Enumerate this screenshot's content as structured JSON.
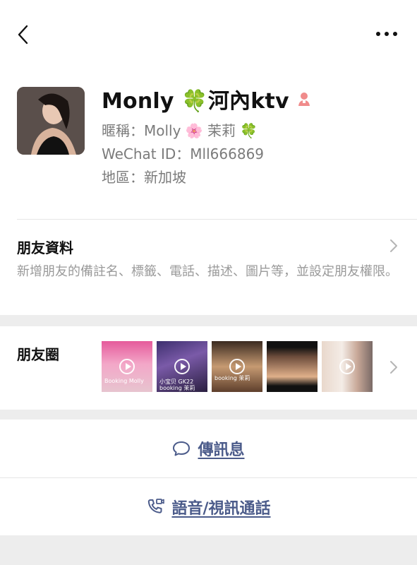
{
  "header": {
    "back_icon": "chevron-left-icon",
    "more_icon": "more-dots-icon"
  },
  "profile": {
    "name": "Monly 🍀河內ktv",
    "gender_icon": "female-icon",
    "nickname": "暱稱：Molly 🌸 茉莉 🍀",
    "wechat_id": "WeChat ID：Mll666869",
    "region": "地區：新加坡"
  },
  "friend_info": {
    "title": "朋友資料",
    "description": "新增朋友的備註名、標籤、電話、描述、圖片等，並設定朋友權限。"
  },
  "moments": {
    "title": "朋友圈",
    "thumbs": [
      {
        "caption": "Booking Molly"
      },
      {
        "caption": "小宝贝 GK22\nbooking 茉莉"
      },
      {
        "caption": "booking 茉莉"
      },
      {
        "caption": ""
      },
      {
        "caption": ""
      }
    ]
  },
  "actions": {
    "message_label": "傳訊息",
    "call_label": "語音/視訊通話"
  },
  "colors": {
    "accent": "#4b5b8a",
    "background": "#ededed",
    "muted": "#9a9a9a"
  }
}
